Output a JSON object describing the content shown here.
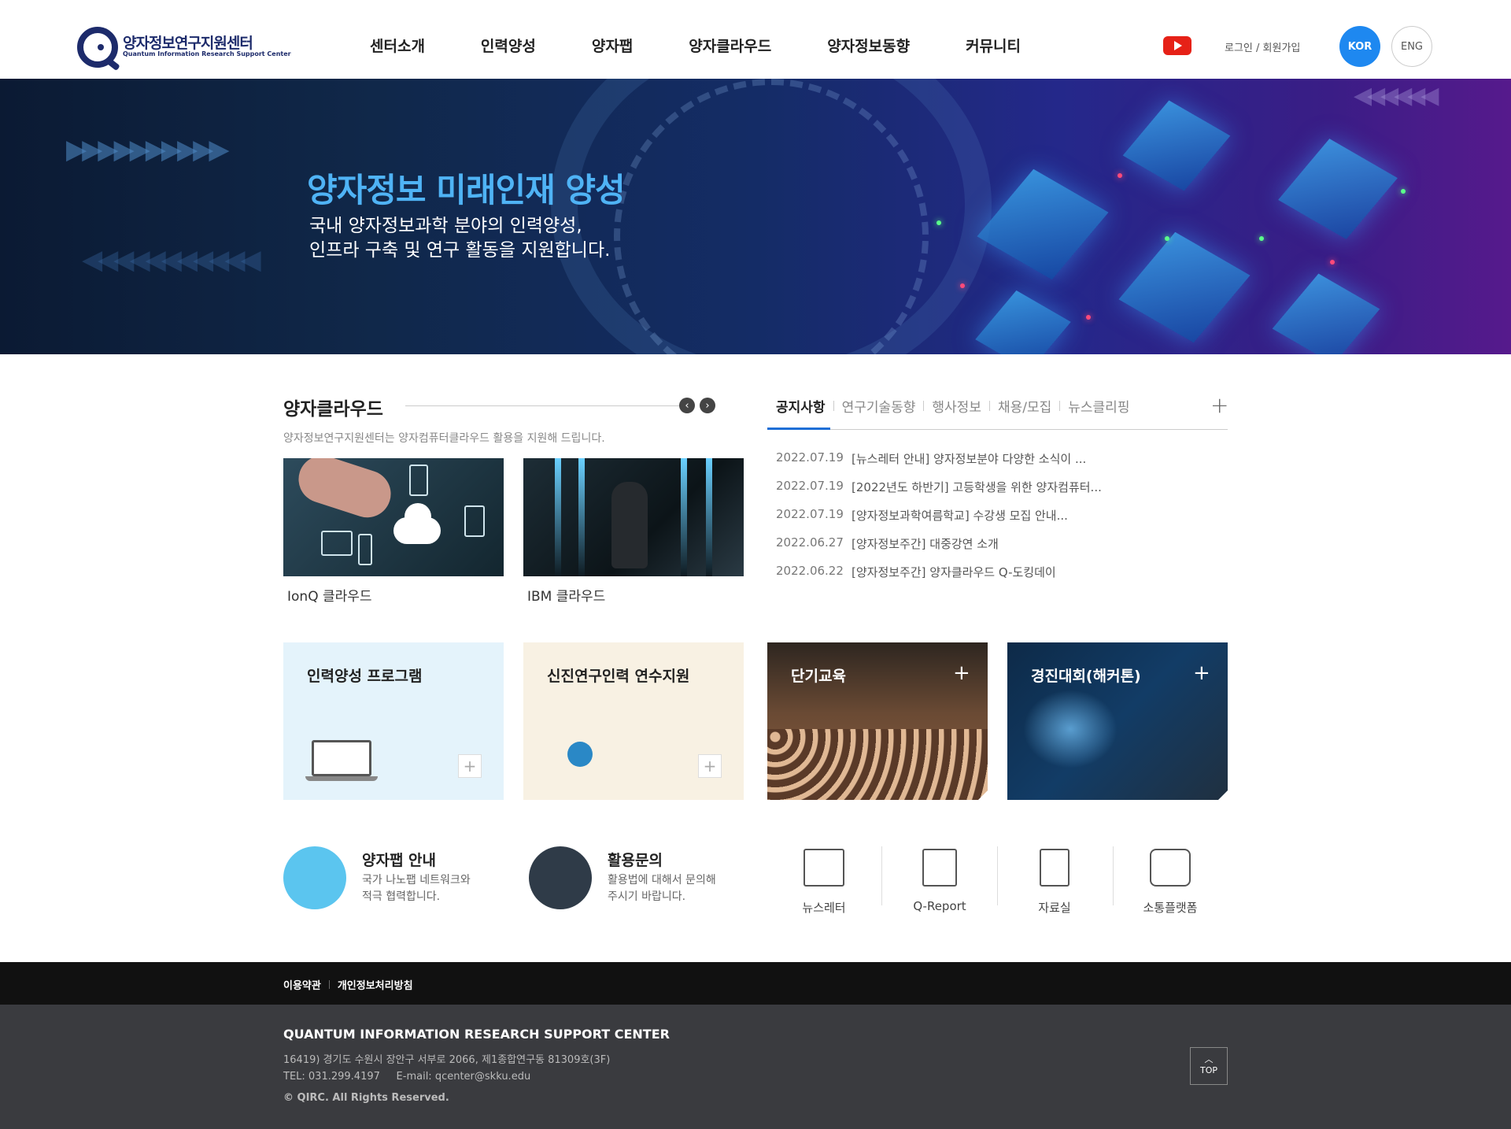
{
  "header": {
    "logo_ko": "양자정보연구지원센터",
    "logo_en": "Quantum Information Research Support Center",
    "nav": [
      "센터소개",
      "인력양성",
      "양자팹",
      "양자클라우드",
      "양자정보동향",
      "커뮤니티"
    ],
    "login": "로그인 / 회원가입",
    "lang_kor": "KOR",
    "lang_eng": "ENG"
  },
  "hero": {
    "title": "양자정보 미래인재 양성",
    "subtitle_line1": "국내 양자정보과학 분야의 인력양성,",
    "subtitle_line2": "인프라 구축 및 연구 활동을 지원합니다."
  },
  "cloud": {
    "title": "양자클라우드",
    "desc": "양자정보연구지원센터는 양자컴퓨터클라우드 활용을 지원해 드립니다.",
    "prev": "‹",
    "next": "›",
    "items": [
      {
        "caption": "IonQ 클라우드"
      },
      {
        "caption": "IBM 클라우드"
      }
    ]
  },
  "notice": {
    "tabs": [
      "공지사항",
      "연구기술동향",
      "행사정보",
      "채용/모집",
      "뉴스클리핑"
    ],
    "more": "+",
    "items": [
      {
        "date": "2022.07.19",
        "title": "[뉴스레터 안내] 양자정보분야 다양한 소식이 ..."
      },
      {
        "date": "2022.07.19",
        "title": "[2022년도 하반기] 고등학생을 위한 양자컴퓨터..."
      },
      {
        "date": "2022.07.19",
        "title": "[양자정보과학여름학교] 수강생 모집 안내..."
      },
      {
        "date": "2022.06.27",
        "title": "[양자정보주간] 대중강연 소개"
      },
      {
        "date": "2022.06.22",
        "title": "[양자정보주간] 양자클라우드 Q-도킹데이"
      }
    ]
  },
  "boxes": [
    {
      "title": "인력양성 프로그램",
      "plus": "+"
    },
    {
      "title": "신진연구인력 연수지원",
      "plus": "+"
    },
    {
      "title": "단기교육",
      "plus": "+"
    },
    {
      "title": "경진대회(해커톤)",
      "plus": "+"
    }
  ],
  "info": [
    {
      "title": "양자팹 안내",
      "desc1": "국가 나노팹 네트워크와",
      "desc2": "적극 협력합니다."
    },
    {
      "title": "활용문의",
      "desc1": "활용법에 대해서 문의해",
      "desc2": "주시기 바랍니다."
    }
  ],
  "quick": [
    "뉴스레터",
    "Q-Report",
    "자료실",
    "소통플랫폼"
  ],
  "footer": {
    "terms": "이용약관",
    "privacy": "개인정보처리방침",
    "name": "QUANTUM INFORMATION RESEARCH SUPPORT CENTER",
    "address": "16419) 경기도 수원시 장안구 서부로 2066, 제1종합연구동 81309호(3F)",
    "contact": "TEL: 031.299.4197     E-mail: qcenter@skku.edu",
    "copyright": "© QIRC.  All Rights Reserved.",
    "top": "TOP"
  }
}
